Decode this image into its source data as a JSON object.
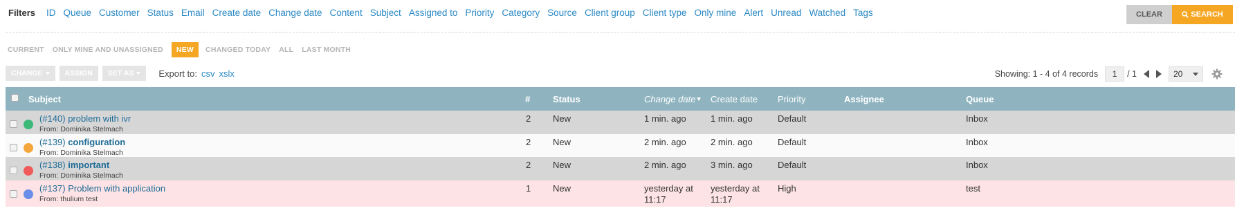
{
  "filters": {
    "label": "Filters",
    "links": [
      "ID",
      "Queue",
      "Customer",
      "Status",
      "Email",
      "Create date",
      "Change date",
      "Content",
      "Subject",
      "Assigned to",
      "Priority",
      "Category",
      "Source",
      "Client group",
      "Client type",
      "Only mine",
      "Alert",
      "Unread",
      "Watched",
      "Tags"
    ],
    "clear_label": "CLEAR",
    "search_label": "SEARCH"
  },
  "quick_tabs": [
    "CURRENT",
    "ONLY MINE AND UNASSIGNED",
    "NEW",
    "CHANGED TODAY",
    "ALL",
    "LAST MONTH"
  ],
  "quick_tab_active": "NEW",
  "actions": {
    "change_label": "CHANGE",
    "assign_label": "ASSIGN",
    "set_as_label": "SET AS",
    "export_label": "Export to:",
    "export_csv": "csv",
    "export_xlsx": "xslx"
  },
  "pager": {
    "showing": "Showing: 1 - 4 of 4 records",
    "page": "1",
    "total": "/ 1",
    "per_page": "20"
  },
  "columns": {
    "subject": "Subject",
    "num": "#",
    "status": "Status",
    "change_date": "Change date",
    "create_date": "Create date",
    "priority": "Priority",
    "assignee": "Assignee",
    "queue": "Queue"
  },
  "rows": [
    {
      "id": "(#140)",
      "subject": "problem with ivr",
      "from": "From: Dominika Stelmach",
      "count": "2",
      "status": "New",
      "change_date": "1 min. ago",
      "change_date_2": "",
      "create_date": "1 min. ago",
      "create_date_2": "",
      "priority": "Default",
      "assignee": "",
      "queue": "Inbox",
      "dot_color": "#3cb878"
    },
    {
      "id": "(#139)",
      "subject": "configuration",
      "from": "From: Dominika Stelmach",
      "count": "2",
      "status": "New",
      "change_date": "2 min. ago",
      "change_date_2": "",
      "create_date": "2 min. ago",
      "create_date_2": "",
      "priority": "Default",
      "assignee": "",
      "queue": "Inbox",
      "dot_color": "#f5a63c"
    },
    {
      "id": "(#138)",
      "subject": "important",
      "from": "From: Dominika Stelmach",
      "count": "2",
      "status": "New",
      "change_date": "2 min. ago",
      "change_date_2": "",
      "create_date": "3 min. ago",
      "create_date_2": "",
      "priority": "Default",
      "assignee": "",
      "queue": "Inbox",
      "dot_color": "#f05a5a"
    },
    {
      "id": "(#137)",
      "subject": "Problem with application",
      "from": "From: thulium test",
      "count": "1",
      "status": "New",
      "change_date": "yesterday at",
      "change_date_2": "11:17",
      "create_date": "yesterday at",
      "create_date_2": "11:17",
      "priority": "High",
      "assignee": "",
      "queue": "test",
      "dot_color": "#6b8fe8"
    }
  ]
}
